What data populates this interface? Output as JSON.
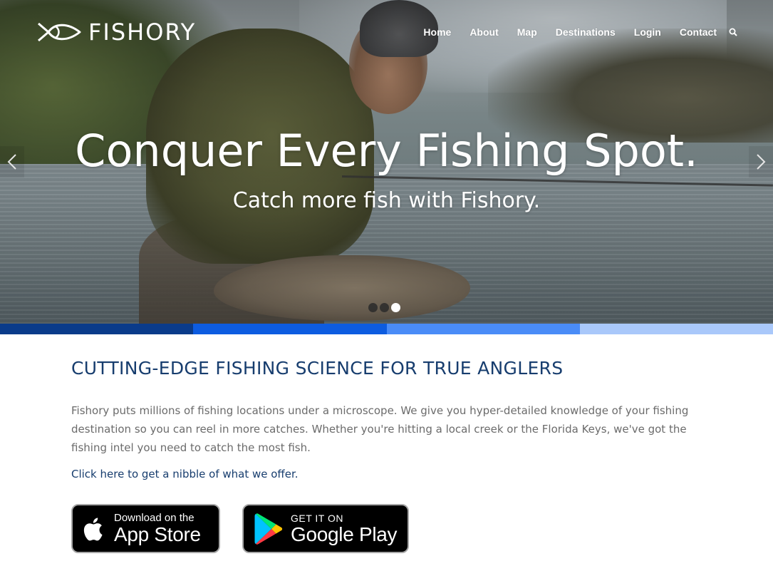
{
  "brand": {
    "name": "FISHORY",
    "logo_icon": "fish-logo-icon"
  },
  "nav": {
    "items": [
      {
        "label": "Home"
      },
      {
        "label": "About"
      },
      {
        "label": "Map"
      },
      {
        "label": "Destinations"
      },
      {
        "label": "Login"
      },
      {
        "label": "Contact"
      }
    ],
    "search_icon": "search-icon"
  },
  "hero": {
    "title": "Conquer Every Fishing Spot.",
    "subtitle": "Catch more fish with Fishory.",
    "prev_icon": "chevron-left-icon",
    "next_icon": "chevron-right-icon",
    "slides_total": 3,
    "active_slide": 3
  },
  "stripe_colors": [
    "#0a3b8a",
    "#0d5ce0",
    "#4a8cf7",
    "#a9c8fa"
  ],
  "content": {
    "heading": "CUTTING-EDGE FISHING SCIENCE FOR TRUE ANGLERS",
    "paragraph": "Fishory puts millions of fishing locations under a microscope. We give you hyper-detailed knowledge of your fishing destination so you can reel in more catches. Whether you're hitting a local creek or the Florida Keys, we've got the fishing intel you need to catch the most fish.",
    "link": "Click here to get a nibble of what we offer."
  },
  "badges": {
    "app_store": {
      "small": "Download on the",
      "big": "App Store",
      "icon": "apple-icon"
    },
    "google_play": {
      "small": "GET IT ON",
      "big": "Google Play",
      "icon": "google-play-icon"
    }
  },
  "colors": {
    "heading": "#173d6e",
    "body_text": "#6b6b6b",
    "link": "#173d6e"
  }
}
